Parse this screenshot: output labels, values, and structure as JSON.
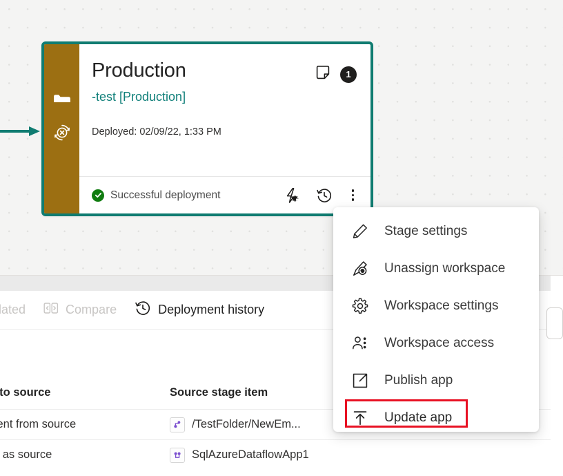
{
  "stage_card": {
    "title": "Production",
    "subtitle": "-test [Production]",
    "deployed_label": "Deployed: 02/09/22, 1:33 PM",
    "badge_count": "1",
    "note_icon": "note-icon",
    "status_text": "Successful deployment",
    "status_icon": "check-circle-icon",
    "rail_icons": [
      "workspace-folder-icon",
      "unassign-refresh-icon"
    ],
    "footer_icons": [
      "deployment-rules-icon",
      "deployment-history-icon",
      "more-options-icon"
    ],
    "border_color": "#107C71",
    "rail_color": "#9C6F12",
    "subtitle_color": "#11807A",
    "status_color": "#107C10"
  },
  "context_menu": {
    "items": [
      {
        "label": "Stage settings",
        "icon": "pencil-icon"
      },
      {
        "label": "Unassign workspace",
        "icon": "pencil-unassign-icon"
      },
      {
        "label": "Workspace settings",
        "icon": "gear-icon"
      },
      {
        "label": "Workspace access",
        "icon": "people-icon"
      },
      {
        "label": "Publish app",
        "icon": "open-external-icon"
      },
      {
        "label": "Update app",
        "icon": "upload-arrow-icon"
      }
    ],
    "highlighted_item": "Update app",
    "highlight_color": "#e81123"
  },
  "lower_pane": {
    "toolbar": [
      {
        "label": "related",
        "icon": "unrelated-icon",
        "disabled": true
      },
      {
        "label": "Compare",
        "icon": "compare-icon",
        "disabled": true
      },
      {
        "label": "Deployment history",
        "icon": "history-icon",
        "disabled": false
      }
    ],
    "table": {
      "columns": [
        "l to source",
        "Source stage item"
      ],
      "rows": [
        {
          "compare": "rent from source",
          "item": "/TestFolder/NewEm...",
          "icon": "dataflow-icon"
        },
        {
          "compare": "e as source",
          "item": "SqlAzureDataflowApp1",
          "icon": "dataflow-icon"
        }
      ]
    }
  },
  "canvas": {
    "arrow": "incoming-arrow",
    "arrow_color": "#107C71",
    "background_color": "#f4f4f3"
  }
}
